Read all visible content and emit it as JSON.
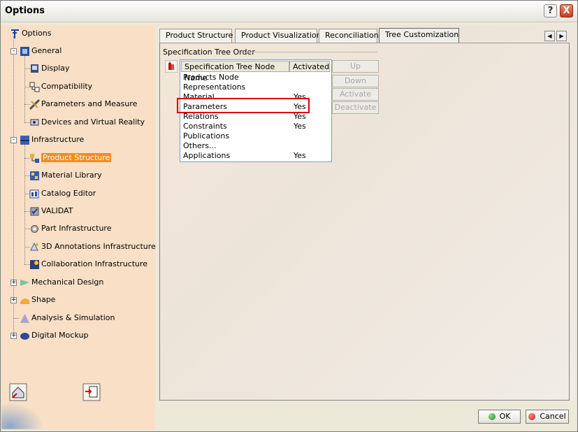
{
  "window": {
    "title": "Options",
    "help_glyph": "?",
    "close_glyph": "X"
  },
  "tree": {
    "root": "Options",
    "general": "General",
    "general_children": [
      "Display",
      "Compatibility",
      "Parameters and Measure",
      "Devices and Virtual Reality"
    ],
    "infrastructure": "Infrastructure",
    "infrastructure_children": [
      "Product Structure",
      "Material Library",
      "Catalog Editor",
      "VALIDAT",
      "Part Infrastructure",
      "3D Annotations Infrastructure",
      "Collaboration Infrastructure"
    ],
    "others": [
      "Mechanical Design",
      "Shape",
      "Analysis & Simulation",
      "Digital Mockup"
    ],
    "expand_glyph": "+",
    "collapse_glyph": "-"
  },
  "tabs": [
    "Product Structure",
    "Product Visualization",
    "Reconciliation",
    "Tree Customization"
  ],
  "active_tab": "Tree Customization",
  "scroll_left_glyph": "◀",
  "scroll_right_glyph": "▶",
  "spec_tree": {
    "group_title": "Specification Tree Order",
    "columns": [
      "Specification Tree Node Name",
      "Activated"
    ],
    "rows": [
      {
        "name": "Products Node",
        "activated": ""
      },
      {
        "name": "Representations",
        "activated": ""
      },
      {
        "name": "Material",
        "activated": "Yes"
      },
      {
        "name": "Parameters",
        "activated": "Yes"
      },
      {
        "name": "Relations",
        "activated": "Yes"
      },
      {
        "name": "Constraints",
        "activated": "Yes"
      },
      {
        "name": "Publications",
        "activated": ""
      },
      {
        "name": "Others...",
        "activated": ""
      },
      {
        "name": "Applications",
        "activated": "Yes"
      }
    ],
    "buttons": [
      "Up",
      "Down",
      "Activate",
      "Deactivate"
    ]
  },
  "footer": {
    "ok": "OK",
    "cancel": "Cancel"
  },
  "colors": {
    "selection": "#f58b1f",
    "highlight": "#d8000f",
    "left_pane": "#f8dfc6"
  }
}
